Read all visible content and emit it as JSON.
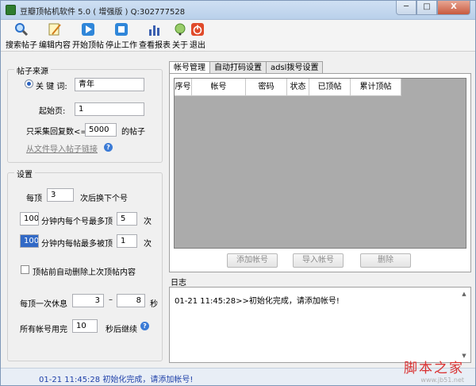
{
  "window": {
    "title": "豆瓣顶帖机软件 5.0 ( 增强版 )  Q:302777528",
    "min_label": "─",
    "max_label": "□",
    "close_label": "X"
  },
  "toolbar": [
    {
      "label": "搜索帖子",
      "icon": "magnifier-icon"
    },
    {
      "label": "编辑内容",
      "icon": "edit-note-icon"
    },
    {
      "label": "开始顶帖",
      "icon": "play-icon"
    },
    {
      "label": "停止工作",
      "icon": "stop-icon"
    },
    {
      "label": "查看报表",
      "icon": "bar-chart-icon"
    },
    {
      "label": "关于",
      "icon": "about-icon"
    },
    {
      "label": "退出",
      "icon": "power-icon"
    }
  ],
  "source": {
    "title": "帖子来源",
    "keyword_label": "关 键 词:",
    "keyword_value": "青年",
    "start_page_label": "起始页:",
    "start_page_value": "1",
    "max_replies_prefix": "只采集回复数<=",
    "max_replies_value": "5000",
    "max_replies_suffix": "的帖子",
    "import_link": "从文件导入帖子链接"
  },
  "settings": {
    "title": "设置",
    "per_prefix": "每顶",
    "per_value": "3",
    "per_suffix": "次后换下个号",
    "minutes1_value": "100",
    "minutes1_mid": "分钟内每个号最多顶",
    "minutes1_max": "5",
    "minutes1_unit": "次",
    "minutes2_value": "100",
    "minutes2_mid": "分钟内每帖最多被顶",
    "minutes2_max": "1",
    "minutes2_unit": "次",
    "auto_delete_label": "顶帖前自动删除上次顶帖内容",
    "rest_label": "每顶一次休息",
    "rest_from": "3",
    "rest_dash": "–",
    "rest_to": "8",
    "rest_unit": "秒",
    "all_used_label": "所有帐号用完",
    "all_used_value": "10",
    "all_used_suffix": "秒后继续"
  },
  "tabs": [
    "帐号管理",
    "自动打码设置",
    "adsl拨号设置"
  ],
  "grid_columns": [
    "序号",
    "帐号",
    "密码",
    "状态",
    "已顶帖",
    "累计顶帖"
  ],
  "buttons": {
    "add": "添加帐号",
    "import": "导入帐号",
    "delete": "删除"
  },
  "log": {
    "title": "日志",
    "line": "01-21 11:45:28>>初始化完成，请添加帐号!"
  },
  "status": "01-21 11:45:28 初始化完成，请添加帐号!",
  "watermark": {
    "main": "脚本之家",
    "url": "www.jb51.net"
  }
}
